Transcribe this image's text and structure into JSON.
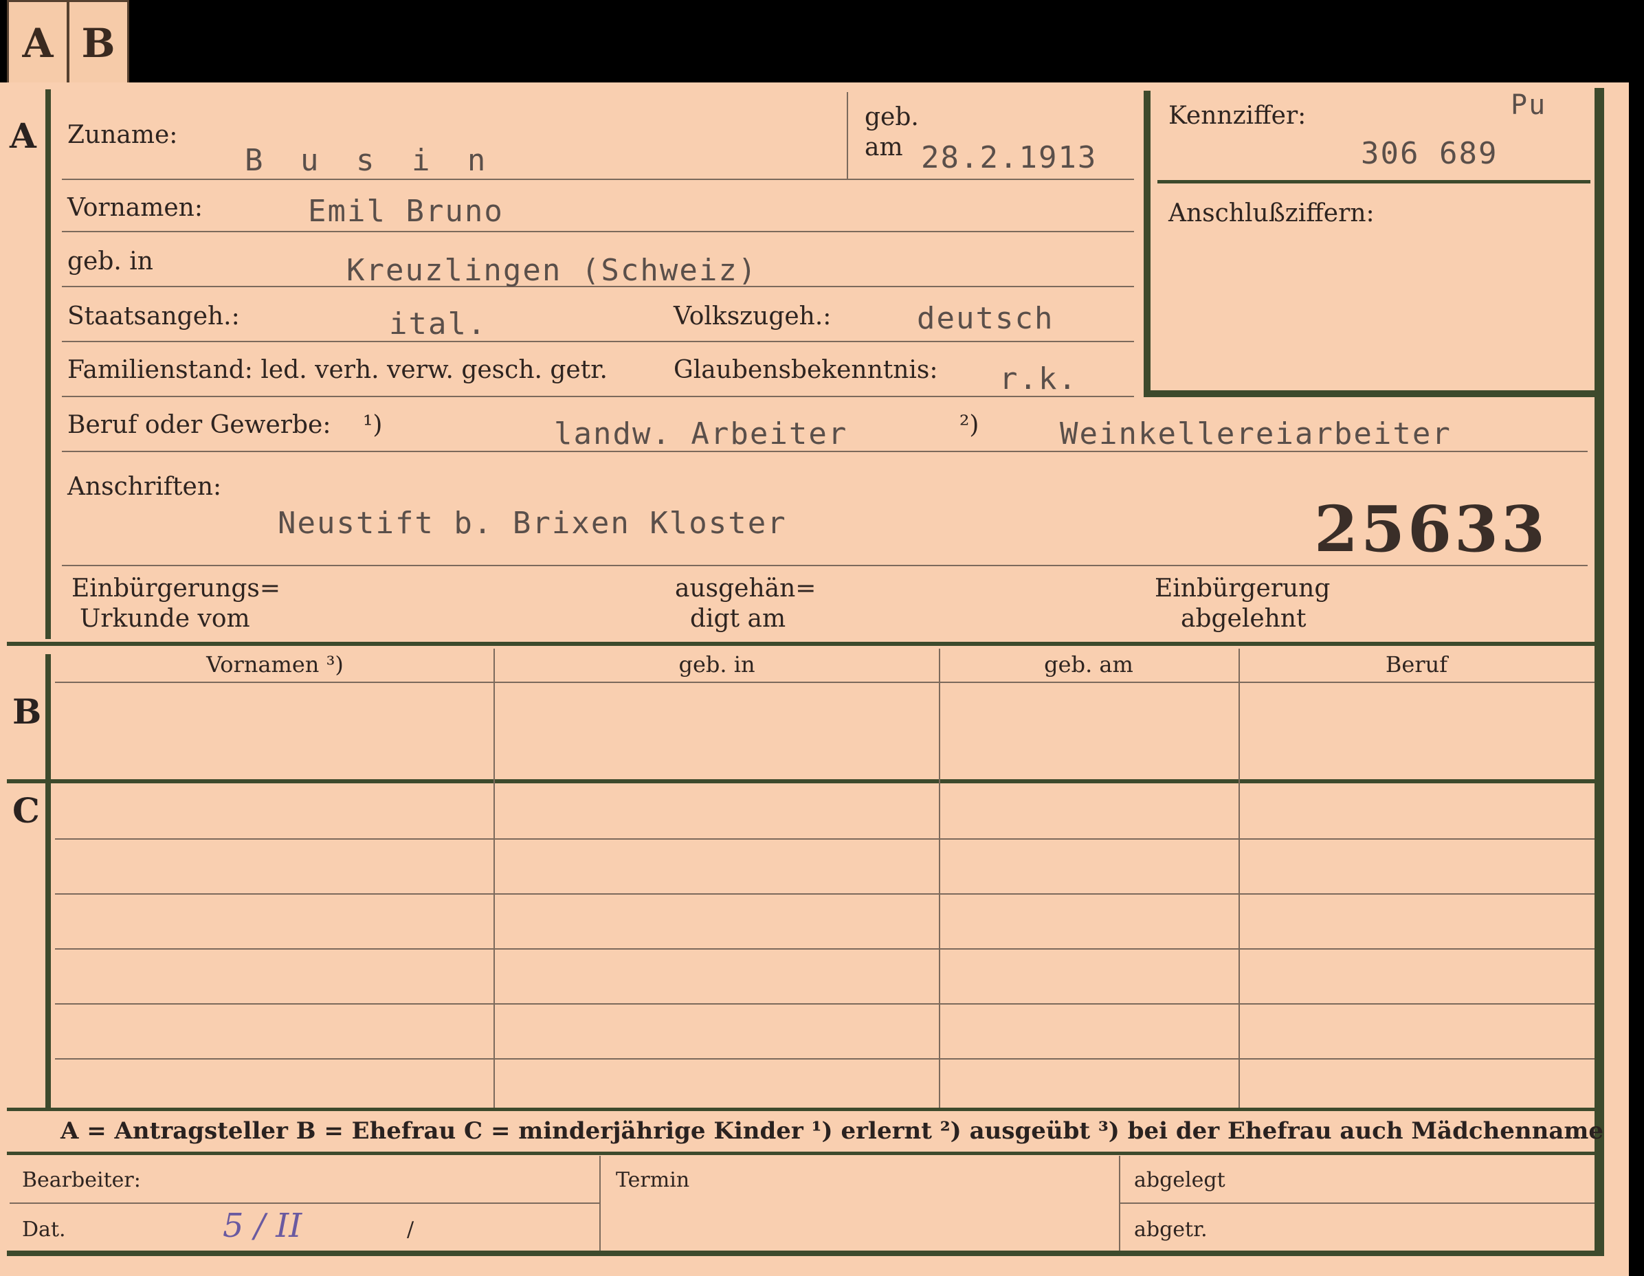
{
  "tabs": [
    "A",
    "B"
  ],
  "sections": {
    "a": "A",
    "b": "B",
    "c": "C"
  },
  "labels": {
    "zuname": "Zuname:",
    "geb": "geb.",
    "am": "am",
    "kennziffer": "Kennziffer:",
    "anschluss": "Anschlußziffern:",
    "vornamen": "Vornamen:",
    "geb_in": "geb. in",
    "staatsangeh": "Staatsangeh.:",
    "volkszugeh": "Volkszugeh.:",
    "familienstand": "Familienstand: led. verh. verw. gesch. getr.",
    "glaubens": "Glaubensbekenntnis:",
    "beruf": "Beruf oder Gewerbe:",
    "fn1": "¹)",
    "fn2": "²)",
    "anschriften": "Anschriften:",
    "einb_urk_1": "Einbürgerungs=",
    "einb_urk_2": "Urkunde vom",
    "ausgeh_1": "ausgehän=",
    "ausgeh_2": "digt am",
    "einb_abg_1": "Einbürgerung",
    "einb_abg_2": "abgelehnt",
    "bearbeiter": "Bearbeiter:",
    "termin": "Termin",
    "abgelegt": "abgelegt",
    "dat": "Dat.",
    "abgetr": "abgetr."
  },
  "values": {
    "zuname": "B u s i n",
    "geb_am": "28.2.1913",
    "kennziffer_mark": "Pu",
    "kennziffer": "306 689",
    "vornamen": "Emil Bruno",
    "geb_in": "Kreuzlingen (Schweiz)",
    "staatsangeh": "ital.",
    "volkszugeh": "deutsch",
    "glaubens": "r.k.",
    "beruf_erlernt": "landw. Arbeiter",
    "beruf_ausgeuebt": "Weinkellereiarbeiter",
    "anschrift": "Neustift b. Brixen  Kloster",
    "number": "25633",
    "dat_hand": "5 / II",
    "dat_slash": "/"
  },
  "table": {
    "headers": [
      "Vornamen ³)",
      "geb. in",
      "geb. am",
      "Beruf"
    ]
  },
  "legend": "A = Antragsteller   B = Ehefrau   C = minderjährige Kinder   ¹) erlernt   ²) ausgeübt   ³) bei der Ehefrau auch Mädchenname"
}
